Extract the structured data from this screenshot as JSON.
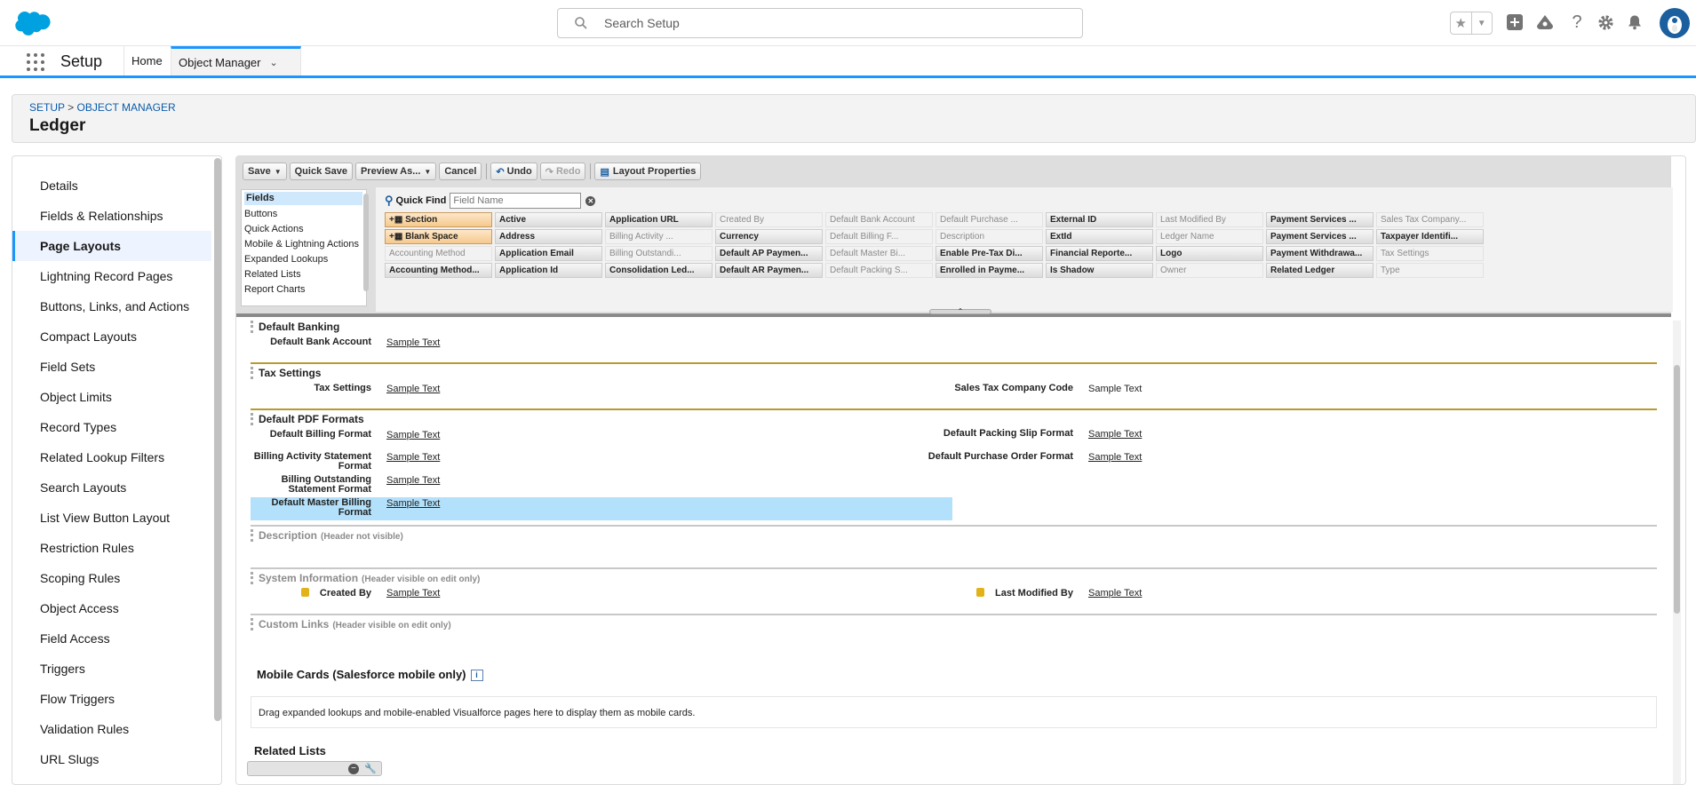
{
  "header": {
    "search_placeholder": "Search Setup",
    "icons": [
      "star-icon",
      "chevron-down-icon",
      "add-icon",
      "trailhead-icon",
      "help-icon",
      "gear-icon",
      "bell-icon",
      "avatar"
    ]
  },
  "nav": {
    "app_name": "Setup",
    "tabs": [
      {
        "label": "Home"
      },
      {
        "label": "Object Manager"
      }
    ]
  },
  "page": {
    "breadcrumb_setup": "SETUP",
    "breadcrumb_sep": ">",
    "breadcrumb_object_manager": "OBJECT MANAGER",
    "title": "Ledger"
  },
  "sidebar": {
    "items": [
      {
        "label": "Details"
      },
      {
        "label": "Fields & Relationships"
      },
      {
        "label": "Page Layouts",
        "active": true
      },
      {
        "label": "Lightning Record Pages"
      },
      {
        "label": "Buttons, Links, and Actions"
      },
      {
        "label": "Compact Layouts"
      },
      {
        "label": "Field Sets"
      },
      {
        "label": "Object Limits"
      },
      {
        "label": "Record Types"
      },
      {
        "label": "Related Lookup Filters"
      },
      {
        "label": "Search Layouts"
      },
      {
        "label": "List View Button Layout"
      },
      {
        "label": "Restriction Rules"
      },
      {
        "label": "Scoping Rules"
      },
      {
        "label": "Object Access"
      },
      {
        "label": "Field Access"
      },
      {
        "label": "Triggers"
      },
      {
        "label": "Flow Triggers"
      },
      {
        "label": "Validation Rules"
      },
      {
        "label": "URL Slugs"
      }
    ]
  },
  "toolbar": {
    "save": "Save",
    "quick_save": "Quick Save",
    "preview_as": "Preview As...",
    "cancel": "Cancel",
    "undo": "Undo",
    "redo": "Redo",
    "layout_properties": "Layout Properties"
  },
  "palette": {
    "categories": [
      "Fields",
      "Buttons",
      "Quick Actions",
      "Mobile & Lightning Actions",
      "Expanded Lookups",
      "Related Lists",
      "Report Charts"
    ],
    "quick_find_label": "Quick Find",
    "quick_find_placeholder": "Field Name",
    "fields": [
      [
        "Section",
        "Active",
        "Application URL",
        "Created By",
        "Default Bank Account",
        "Default Purchase ...",
        "External ID",
        "Last Modified By",
        "Payment Services ...",
        "Sales Tax Company..."
      ],
      [
        "Blank Space",
        "Address",
        "Billing Activity ...",
        "Currency",
        "Default Billing F...",
        "Description",
        "ExtId",
        "Ledger Name",
        "Payment Services ...",
        "Taxpayer Identifi..."
      ],
      [
        "Accounting Method",
        "Application Email",
        "Billing Outstandi...",
        "Default AP Paymen...",
        "Default Master Bi...",
        "Enable Pre-Tax Di...",
        "Financial Reporte...",
        "Logo",
        "Payment Withdrawa...",
        "Tax Settings"
      ],
      [
        "Accounting Method...",
        "Application Id",
        "Consolidation Led...",
        "Default AR Paymen...",
        "Default Packing S...",
        "Enrolled in Payme...",
        "Is Shadow",
        "Owner",
        "Related Ledger",
        "Type"
      ]
    ],
    "used_fields": [
      [
        false,
        false,
        false,
        true,
        true,
        true,
        false,
        true,
        false,
        true
      ],
      [
        false,
        false,
        true,
        false,
        true,
        true,
        false,
        true,
        false,
        false
      ],
      [
        true,
        false,
        true,
        false,
        true,
        false,
        false,
        false,
        false,
        true
      ],
      [
        false,
        false,
        false,
        false,
        true,
        false,
        false,
        true,
        false,
        true
      ]
    ]
  },
  "layout": {
    "default_banking": {
      "title": "Default Banking",
      "fields": [
        {
          "label": "Default Bank Account",
          "value": "Sample Text"
        }
      ]
    },
    "tax_settings": {
      "title": "Tax Settings",
      "left": {
        "label": "Tax Settings",
        "value": "Sample Text"
      },
      "right": {
        "label": "Sales Tax Company Code",
        "value": "Sample Text"
      }
    },
    "pdf_formats": {
      "title": "Default PDF Formats",
      "left": [
        {
          "label": "Default Billing Format",
          "value": "Sample Text"
        },
        {
          "label": "Billing Activity Statement Format",
          "value": "Sample Text"
        },
        {
          "label": "Billing Outstanding Statement Format",
          "value": "Sample Text"
        },
        {
          "label": "Default Master Billing Format",
          "value": "Sample Text"
        }
      ],
      "right": [
        {
          "label": "Default Packing Slip Format",
          "value": "Sample Text"
        },
        {
          "label": "Default Purchase Order Format",
          "value": "Sample Text"
        }
      ]
    },
    "description": {
      "title": "Description",
      "note": "(Header not visible)"
    },
    "system_info": {
      "title": "System Information",
      "note": "(Header visible on edit only)",
      "left": {
        "label": "Created By",
        "value": "Sample Text"
      },
      "right": {
        "label": "Last Modified By",
        "value": "Sample Text"
      }
    },
    "custom_links": {
      "title": "Custom Links",
      "note": "(Header visible on edit only)"
    },
    "mobile_cards": {
      "title": "Mobile Cards (Salesforce mobile only)",
      "info": "i",
      "hint": "Drag expanded lookups and mobile-enabled Visualforce pages here to display them as mobile cards."
    },
    "related_lists": {
      "title": "Related Lists"
    }
  },
  "colors": {
    "brand": "#1b96ff",
    "link": "#0b5cab",
    "section_rule": "#b89a2e",
    "highlight": "#b3e1fb"
  }
}
